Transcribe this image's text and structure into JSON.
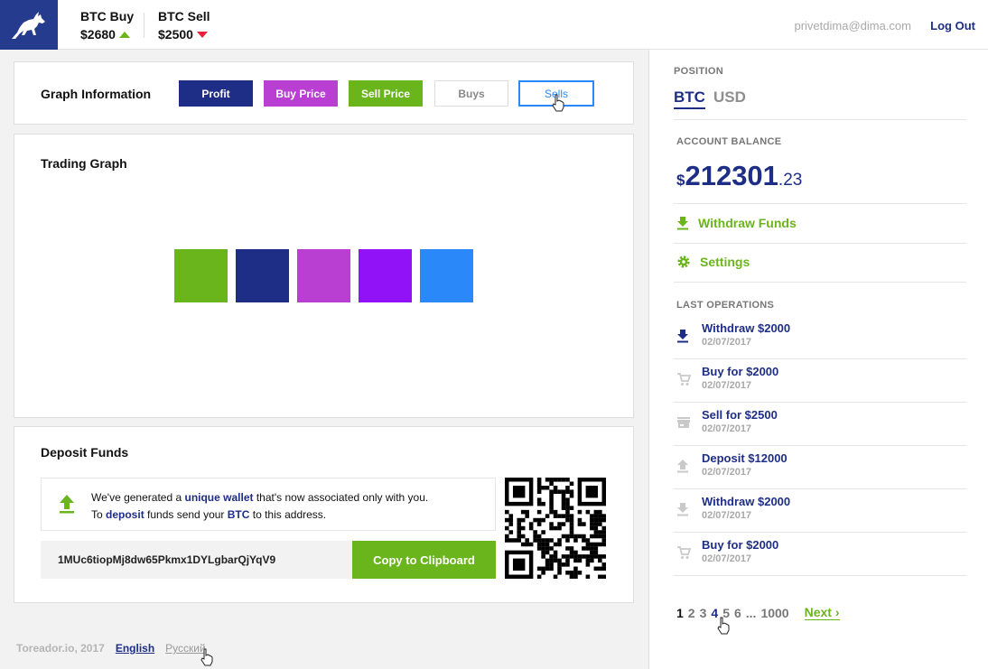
{
  "header": {
    "btc_buy": {
      "label": "BTC Buy",
      "value": "$2680"
    },
    "btc_sell": {
      "label": "BTC Sell",
      "value": "$2500"
    },
    "email": "privetdima@dima.com",
    "logout": "Log Out"
  },
  "graph_info": {
    "title": "Graph Information",
    "buttons": [
      {
        "label": "Profit",
        "color": "#1e2e87"
      },
      {
        "label": "Buy Price",
        "color": "#b83fd2"
      },
      {
        "label": "Sell Price",
        "color": "#6ab51c"
      },
      {
        "label": "Buys",
        "color": "#ffffff"
      },
      {
        "label": "Sells",
        "color": "#ffffff"
      }
    ]
  },
  "trading_graph": {
    "title": "Trading Graph",
    "swatches": [
      "#6ab51c",
      "#1e2e87",
      "#b83fd2",
      "#9112f7",
      "#2b88f8"
    ]
  },
  "deposit": {
    "title": "Deposit Funds",
    "notice_line1_a": "We've generated a ",
    "notice_line1_b": "unique wallet",
    "notice_line1_c": " that's now associated only with you.",
    "notice_line2_a": "To ",
    "notice_line2_b": "deposit",
    "notice_line2_c": " funds send your ",
    "notice_line2_d": "BTC",
    "notice_line2_e": " to this address.",
    "wallet_address": "1MUc6tiopMj8dw65Pkmx1DYLgbarQjYqV9",
    "copy_button": "Copy to Clipboard"
  },
  "footer": {
    "copyright": "Toreador.io, 2017",
    "lang_en": "English",
    "lang_ru": "Русский"
  },
  "sidebar": {
    "position_label": "POSITION",
    "tab_btc": "BTC",
    "tab_usd": "USD",
    "balance_label": "ACCOUNT BALANCE",
    "balance_currency": "$",
    "balance_int": "212301",
    "balance_dec": ".23",
    "withdraw_link": "Withdraw Funds",
    "settings_link": "Settings",
    "last_ops_label": "LAST OPERATIONS",
    "operations": [
      {
        "title": "Withdraw $2000",
        "date": "02/07/2017",
        "icon": "download-icon"
      },
      {
        "title": "Buy for $2000",
        "date": "02/07/2017",
        "icon": "cart-icon"
      },
      {
        "title": "Sell for $2500",
        "date": "02/07/2017",
        "icon": "store-icon"
      },
      {
        "title": "Deposit $12000",
        "date": "02/07/2017",
        "icon": "upload-icon"
      },
      {
        "title": "Withdraw $2000",
        "date": "02/07/2017",
        "icon": "download-icon"
      },
      {
        "title": "Buy for $2000",
        "date": "02/07/2017",
        "icon": "cart-icon"
      }
    ],
    "pager": {
      "pages": [
        "1",
        "2",
        "3",
        "4",
        "5",
        "6"
      ],
      "ellipsis": "...",
      "last": "1000",
      "next": "Next"
    }
  }
}
